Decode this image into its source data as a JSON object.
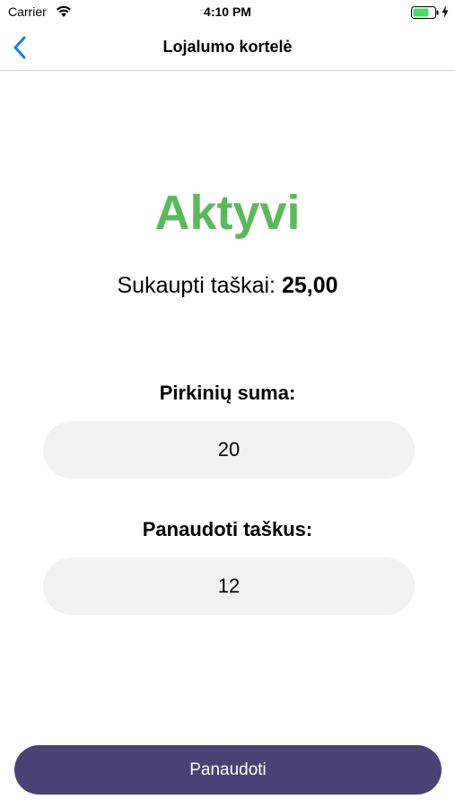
{
  "status_bar": {
    "carrier": "Carrier",
    "time": "4:10 PM",
    "battery_color": "#4cd964",
    "icons": [
      "wifi-icon",
      "battery-icon",
      "charging-icon"
    ]
  },
  "nav": {
    "title": "Lojalumo kortelė",
    "back_icon": "chevron-left-icon",
    "accent_color": "#1a7cf4"
  },
  "card": {
    "status": "Aktyvi",
    "status_color": "#5cb85c",
    "points_label": "Sukaupti taškai: ",
    "points_value": "25,00"
  },
  "form": {
    "purchase_sum_label": "Pirkinių suma:",
    "purchase_sum_value": "20",
    "use_points_label": "Panaudoti taškus:",
    "use_points_value": "12"
  },
  "actions": {
    "redeem_label": "Panaudoti",
    "redeem_color": "#4a4174"
  }
}
